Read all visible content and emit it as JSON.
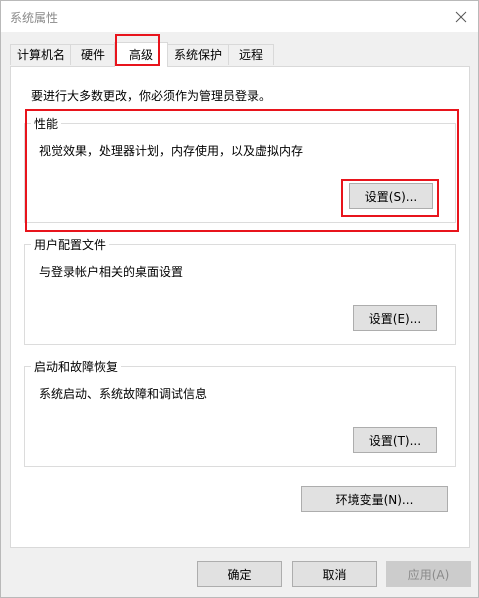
{
  "window": {
    "title": "系统属性",
    "close_symbol": "✕"
  },
  "tabs": [
    {
      "label": "计算机名"
    },
    {
      "label": "硬件"
    },
    {
      "label": "高级"
    },
    {
      "label": "系统保护"
    },
    {
      "label": "远程"
    }
  ],
  "active_tab": "高级",
  "admin_note": "要进行大多数更改，你必须作为管理员登录。",
  "performance": {
    "title": "性能",
    "description": "视觉效果，处理器计划，内存使用，以及虚拟内存",
    "settings_label": "设置(S)..."
  },
  "user_profiles": {
    "title": "用户配置文件",
    "description": "与登录帐户相关的桌面设置",
    "settings_label": "设置(E)..."
  },
  "startup_recovery": {
    "title": "启动和故障恢复",
    "description": "系统启动、系统故障和调试信息",
    "settings_label": "设置(T)..."
  },
  "env_vars_label": "环境变量(N)...",
  "footer": {
    "ok_label": "确定",
    "cancel_label": "取消",
    "apply_label": "应用(A)"
  },
  "colors": {
    "highlight": "#e8141c",
    "button_bg": "#e1e1e1",
    "button_border": "#adadad"
  }
}
